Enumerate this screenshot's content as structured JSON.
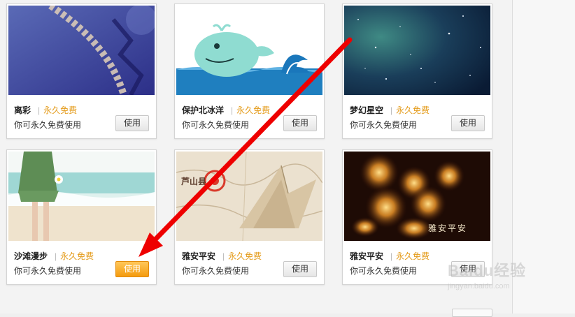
{
  "cards": [
    {
      "name": "离彩",
      "price": "永久免费",
      "desc": "你可永久免费使用",
      "button": "使用"
    },
    {
      "name": "保护北冰洋",
      "price": "永久免费",
      "desc": "你可永久免费使用",
      "button": "使用"
    },
    {
      "name": "梦幻星空",
      "price": "永久免费",
      "desc": "你可永久免费使用",
      "button": "使用"
    },
    {
      "name": "沙滩漫步",
      "price": "永久免费",
      "desc": "你可永久免费使用",
      "button": "使用"
    },
    {
      "name": "雅安平安",
      "price": "永久免费",
      "desc": "你可永久免费使用",
      "button": "使用"
    },
    {
      "name": "雅安平安",
      "price": "永久免费",
      "desc": "你可永久免费使用",
      "button": "使用"
    }
  ],
  "thumb_text": {
    "map_city": "芦山县",
    "candles_caption": "雅安平安"
  },
  "colors": {
    "price": "#e49b1a",
    "active_button": "#f49b0e",
    "arrow": "#ee0000"
  },
  "watermark": {
    "logo": "Baidu经验",
    "url": "jingyan.baidu.com"
  }
}
